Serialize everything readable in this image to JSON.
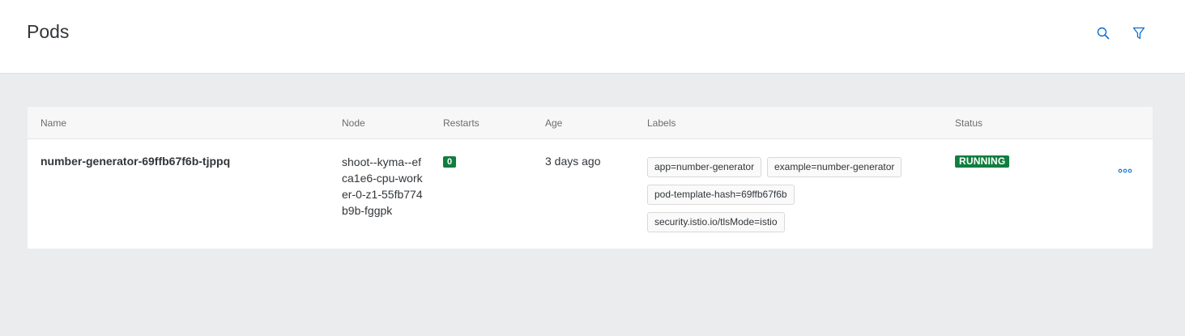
{
  "header": {
    "title": "Pods",
    "search_icon": "search-icon",
    "filter_icon": "filter-icon",
    "icon_color": "#0a6ed1"
  },
  "table": {
    "columns": [
      "Name",
      "Node",
      "Restarts",
      "Age",
      "Labels",
      "Status"
    ],
    "rows": [
      {
        "name": "number-generator-69ffb67f6b-tjppq",
        "node": "shoot--kyma--efca1e6-cpu-worker-0-z1-55fb774b9b-fggpk",
        "restarts": "0",
        "age": "3 days ago",
        "labels": [
          "app=number-generator",
          "example=number-generator",
          "pod-template-hash=69ffb67f6b",
          "security.istio.io/tlsMode=istio"
        ],
        "status": "RUNNING",
        "actions_icon": "more-options-icon"
      }
    ]
  },
  "colors": {
    "status_running": "#107e3e",
    "page_background": "#ebecee",
    "accent": "#0a6ed1"
  }
}
